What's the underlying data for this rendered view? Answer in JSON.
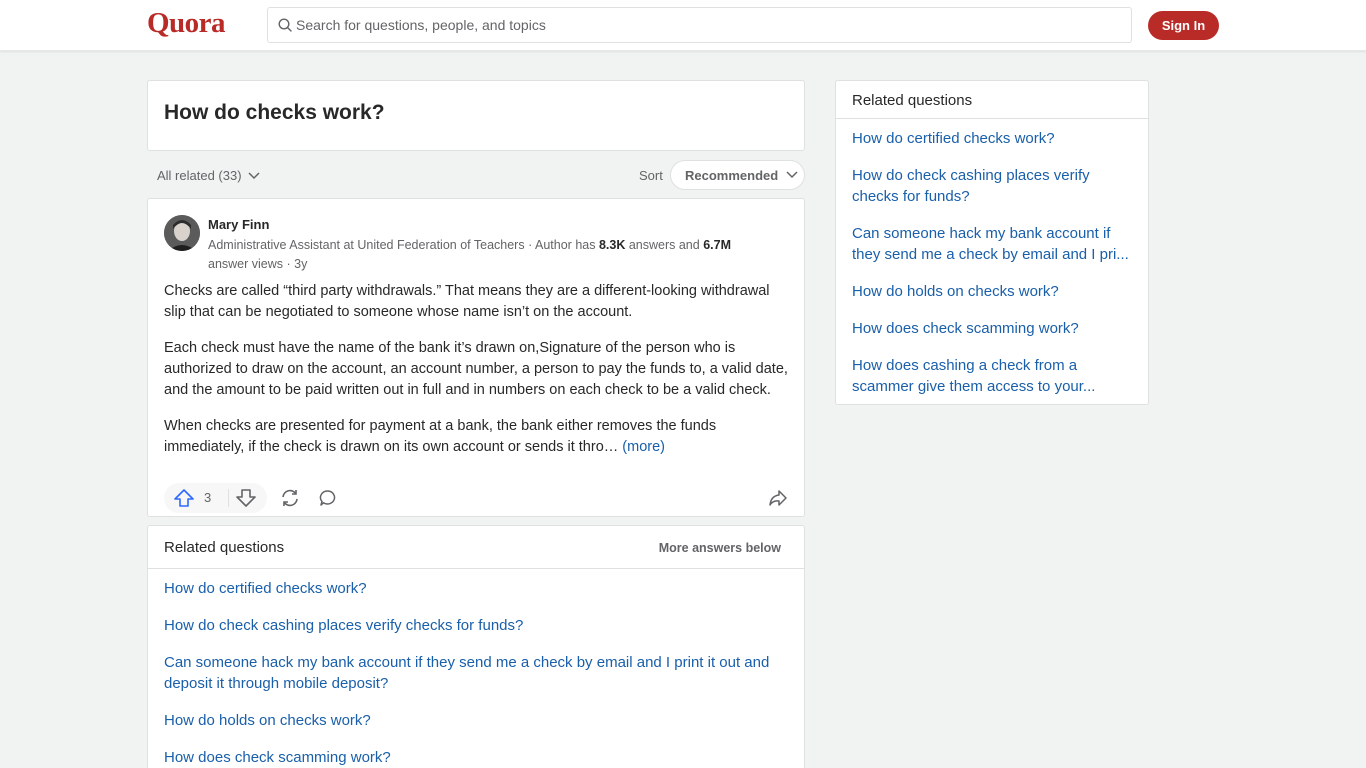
{
  "header": {
    "logo": "Quora",
    "search_placeholder": "Search for questions, people, and topics",
    "signin_label": "Sign In"
  },
  "question": {
    "title": "How do checks work?"
  },
  "filters": {
    "all_related": "All related (33)",
    "sort_label": "Sort",
    "sort_value": "Recommended"
  },
  "answer": {
    "author": "Mary Finn",
    "cred_prefix": "Administrative Assistant at United Federation of Teachers · Author has ",
    "answers_count": "8.3K",
    "cred_mid": " answers and ",
    "views_count": "6.7M",
    "cred_suffix": " answer views · 3y",
    "paragraphs": [
      "Checks are called “third party withdrawals.” That means they are a different-looking withdrawal slip that can be negotiated to someone whose name isn’t on the account.",
      "Each check must have the name of the bank it’s drawn on,Signature of the person who is authorized to draw on the account, an account number, a person to pay the funds to, a valid date, and the amount to be paid written out in full and in numbers on each check to be a valid check.",
      "When checks are presented for payment at a bank, the bank either removes the funds immediately, if the check is drawn on its own account or sends it thro…"
    ],
    "more_label": "(more)",
    "upvotes": "3"
  },
  "related_main": {
    "title": "Related questions",
    "more_below": "More answers below",
    "items": [
      "How do certified checks work?",
      "How do check cashing places verify checks for funds?",
      "Can someone hack my bank account if they send me a check by email and I print it out and deposit it through mobile deposit?",
      "How do holds on checks work?",
      "How does check scamming work?"
    ]
  },
  "related_side": {
    "title": "Related questions",
    "items": [
      "How do certified checks work?",
      "How do check cashing places verify checks for funds?",
      "Can someone hack my bank account if they send me a check by email and I pri...",
      "How do holds on checks work?",
      "How does check scamming work?",
      "How does cashing a check from a scammer give them access to your..."
    ]
  },
  "colors": {
    "brand": "#b92b27",
    "link": "#195faa",
    "upvote": "#2e69ff"
  },
  "icons": [
    "search-icon",
    "chevron-down-icon",
    "upvote-icon",
    "downvote-icon",
    "reshare-icon",
    "comment-icon",
    "share-icon"
  ]
}
